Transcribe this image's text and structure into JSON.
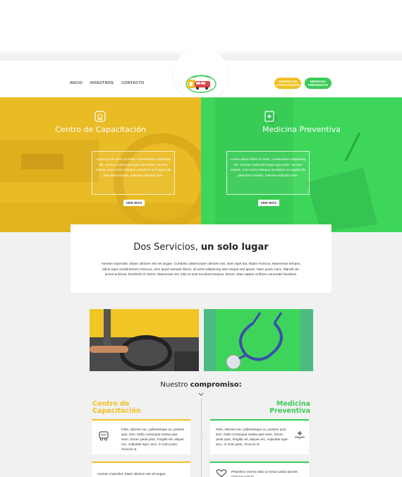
{
  "nav": {
    "items": [
      "INICIO",
      "NOSOTROS",
      "CONTACTO"
    ]
  },
  "buttons": {
    "capacitacion": "CENTRO DE CAPACITACIÓN",
    "medicina": "MEDICINA PREVENTIVA"
  },
  "hero": {
    "left": {
      "title": "Centro de Capacitación",
      "text": "Lorem ipsum dolor sit amet, consectetuer adipiscing elit. Aenean commodo ligula eget dolor. Aenean massa. Cum sociis natoque penatibus et magnis dis parturient montes, nascetur ridiculus mus.",
      "button": "VER MÁS"
    },
    "right": {
      "title": "Medicina Preventiva",
      "text": "Lorem ipsum dolor sit amet, consectetuer adipiscing elit. Aenean commodo ligula eget dolor. Aenean massa. Cum sociis natoque penatibus et magnis dis parturient montes, nascetur ridiculus mus.",
      "button": "VER MÁS"
    }
  },
  "services": {
    "title_regular": "Dos Servicios, ",
    "title_bold": "un solo lugar",
    "text": "Aenean imperdiet. Etiam ultricies nisi vel augue. Curabitur ullamcorper ultricies nisi. Nam eget dui. Etiam rhoncus. Maecenas tempus, tellus eget condimentum rhoncus, sem quam semper libero, sit amet adipiscing sem neque sed ipsum. Nam quam nunc, blandit vel, luctus pulvinar, hendrerit id, lorem. Maecenas nec odio et ante tincidunt tempus. Donec vitae sapien ut libero venenatis faucibus."
  },
  "compromiso": {
    "regular": "Nuestro ",
    "bold": "compromiso:"
  },
  "columns": {
    "left_title": "Centro de Capacitación",
    "right_title": "Medicina Preventiva"
  },
  "cards": {
    "c1": "Felis, ultricies nec, pellentesque eu, pretium quis, sem. Nulla consequat massa quis enim. Donec pede justo, fringilla vel, aliquet nec, vulputate eget, arcu. In enim justo, rhoncus ut.",
    "c2": "Felis, ultricies nec, pellentesque eu, pretium quis, sem. Nulla consequat massa quis enim. Donec pede justo, fringilla vel, aliquet nec, vulputate eget, arcu. In enim justo, rhoncus ut.",
    "c3": "Aenean imperdiet. Etiam ultricies nisi vel augue.",
    "c4": "Phasellus viverra nulla ut metus varius laoreet. Quisque rutrum."
  },
  "colors": {
    "yellow": "#f2c21f",
    "green": "#39cc58"
  }
}
